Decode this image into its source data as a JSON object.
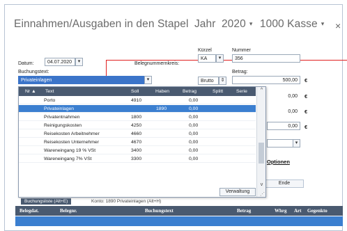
{
  "title": {
    "main": "Einnahmen/Ausgaben in den Stapel",
    "jahr_label": "Jahr",
    "jahr_value": "2020",
    "kasse_value": "1000 Kasse",
    "close": "×"
  },
  "form": {
    "datum_label": "Datum:",
    "datum_value": "04.07.2020",
    "belegnummernkreis_label": "Belegnummernkreis:",
    "kuerzel_label": "Kürzel",
    "kuerzel_value": "KA",
    "nummer_label": "Nummer",
    "nummer_value": "356",
    "buchungstext_label": "Buchungstext:",
    "buchungstext_value": "Privateinlagen",
    "brutto_value": "Brutto",
    "betrag_label": "Betrag:",
    "betrag_value": "500,00",
    "amount_2": "0,00",
    "amount_3": "0,00",
    "amount_4": "0,00",
    "currency": "€",
    "optionen_label": "Optionen",
    "ende_label": "Ende"
  },
  "popup": {
    "headers": {
      "nr": "Nr ▲",
      "text": "Text",
      "soll": "Soll",
      "haben": "Haben",
      "betrag": "Betrag",
      "splitt": "Splitt",
      "serie": "Serie"
    },
    "rows": [
      {
        "text": "Porto",
        "soll": "4910",
        "haben": "",
        "betrag": "0,00"
      },
      {
        "text": "Privateinlagen",
        "soll": "",
        "haben": "1890",
        "betrag": "0,00"
      },
      {
        "text": "Privatentnahmen",
        "soll": "1800",
        "haben": "",
        "betrag": "0,00"
      },
      {
        "text": "Reinigungskosten",
        "soll": "4250",
        "haben": "",
        "betrag": "0,00"
      },
      {
        "text": "Reisekosten Arbeitnehmer",
        "soll": "4660",
        "haben": "",
        "betrag": "0,00"
      },
      {
        "text": "Reisekosten Unternehmer",
        "soll": "4670",
        "haben": "",
        "betrag": "0,00"
      },
      {
        "text": "Wareneingang 19 % VSt",
        "soll": "3400",
        "haben": "",
        "betrag": "0,00"
      },
      {
        "text": "Wareneingang 7% VSt",
        "soll": "3300",
        "haben": "",
        "betrag": "0,00"
      }
    ],
    "verwaltung_label": "Verwaltung",
    "selected_index": 1
  },
  "tabs": {
    "tab1": "Buchungsliste (Alt+E)",
    "tab2": "Konto: 1890 Privateinlagen (Alt+H)"
  },
  "grid": {
    "headers": [
      "Belegdat.",
      "Belegnr.",
      "Buchungstext",
      "Betrag",
      "Whrg",
      "Art",
      "Gegenkto"
    ]
  }
}
